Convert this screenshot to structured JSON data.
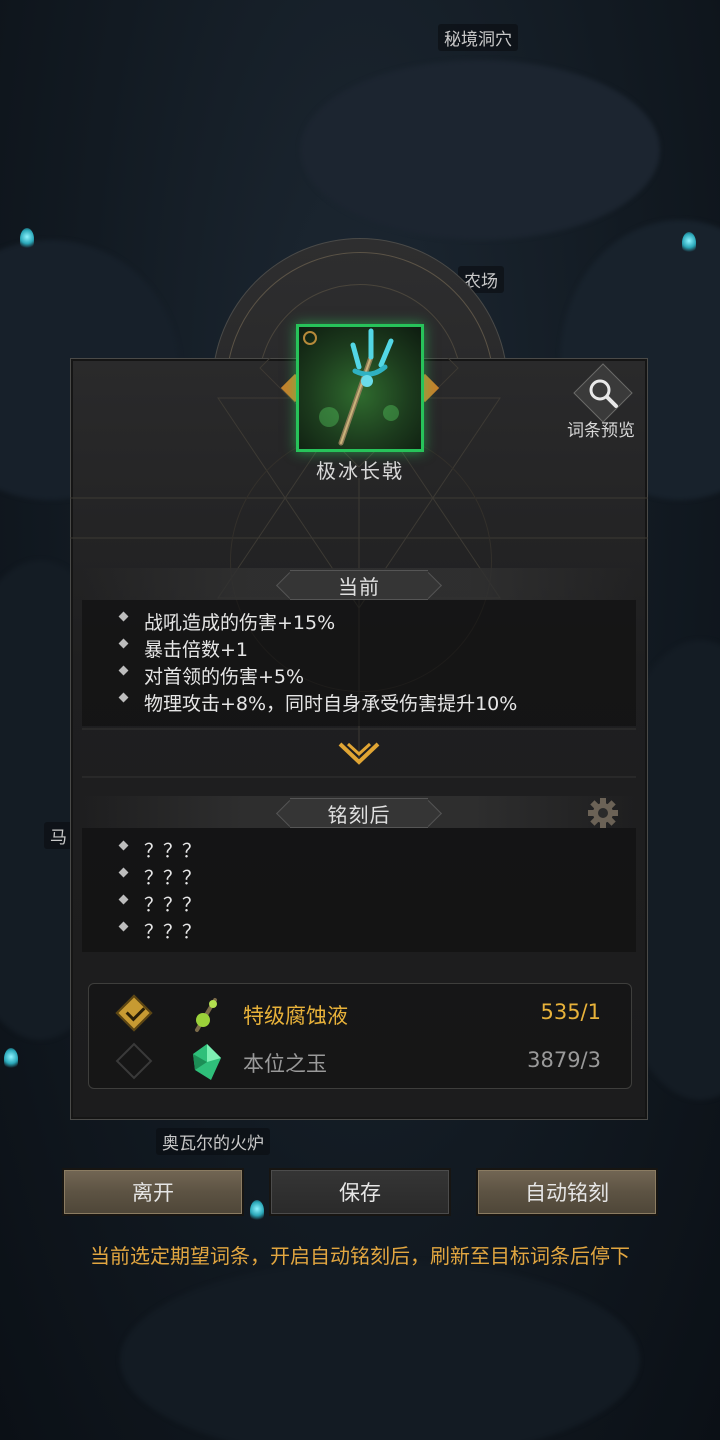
{
  "map": {
    "labels": {
      "secret_cave": "秘境洞穴",
      "farm": "农场",
      "left_partial": "马",
      "forge": "奥瓦尔的火炉"
    }
  },
  "item": {
    "name": "极冰长戟",
    "rarity_color": "#27c35a"
  },
  "preview": {
    "label": "词条预览",
    "icon": "magnifier-icon"
  },
  "current": {
    "title": "当前",
    "stats": [
      "战吼造成的伤害+15%",
      "暴击倍数+1",
      "对首领的伤害+5%",
      "物理攻击+8%，同时自身承受伤害提升10%"
    ]
  },
  "after": {
    "title": "铭刻后",
    "stats": [
      "？？？",
      "？？？",
      "？？？",
      "？？？"
    ]
  },
  "materials": [
    {
      "name": "特级腐蚀液",
      "count": "535/1",
      "selected": true,
      "color": "#e8b23a",
      "icon": "corrosive-liquid-icon"
    },
    {
      "name": "本位之玉",
      "count": "3879/3",
      "selected": false,
      "color": "#9a9a9a",
      "icon": "jade-crystal-icon"
    }
  ],
  "buttons": {
    "leave": "离开",
    "save": "保存",
    "auto": "自动铭刻"
  },
  "hint": "当前选定期望词条，开启自动铭刻后，刷新至目标词条后停下"
}
